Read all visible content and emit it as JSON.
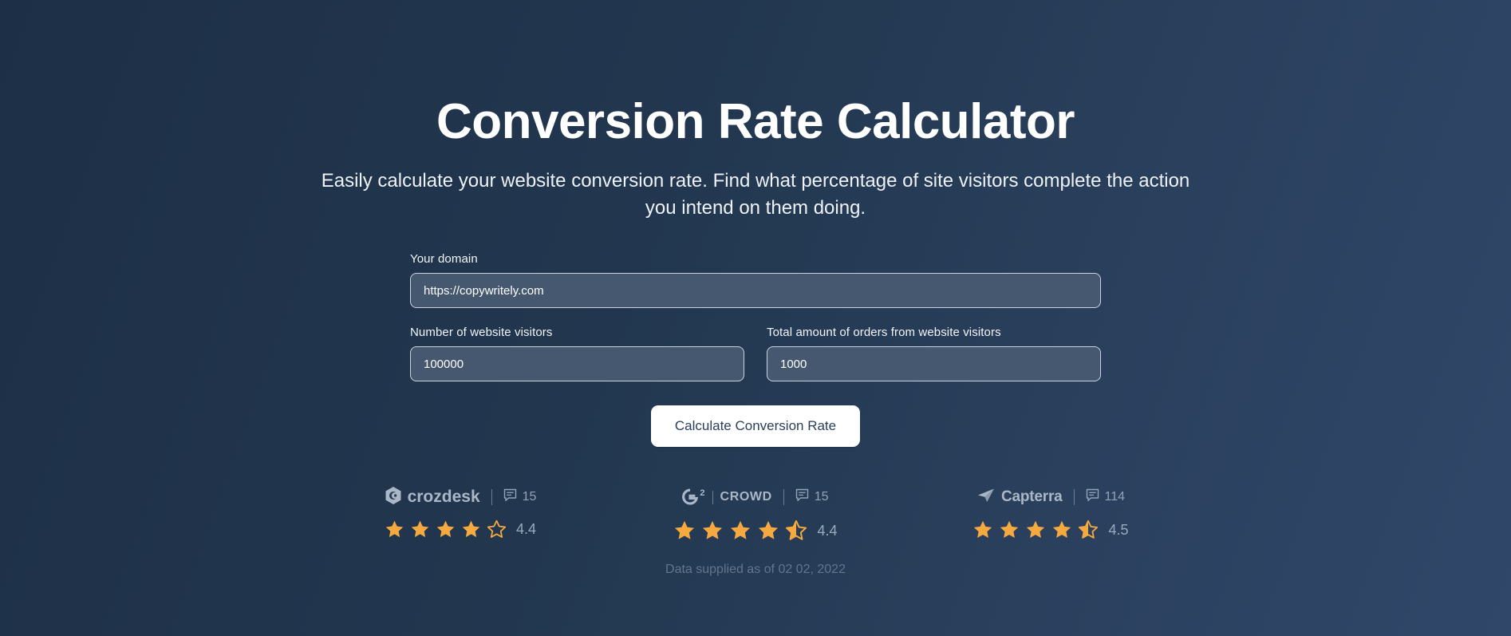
{
  "page": {
    "title": "Conversion Rate Calculator",
    "subtitle": "Easily calculate your website conversion rate. Find what percentage of site visitors complete the action you intend on them doing.",
    "footer_note": "Data supplied as of 02 02, 2022",
    "background_from": "#1d2f47",
    "background_to": "#30476a"
  },
  "form": {
    "domain": {
      "label": "Your domain",
      "value": "https://copywritely.com",
      "placeholder": "https://copywritely.com"
    },
    "visitors": {
      "label": "Number of website visitors",
      "value": "100000",
      "placeholder": "100000"
    },
    "orders": {
      "label": "Total amount of orders from website visitors",
      "value": "1000",
      "placeholder": "1000"
    },
    "submit_label": "Calculate Conversion Rate",
    "input_background": "#46586f",
    "input_border": "#c9d2dd",
    "button_background": "#ffffff",
    "button_text_color": "#2b3e5c"
  },
  "badges": {
    "star_color": "#f5a93f",
    "items": [
      {
        "brand": "crozdesk",
        "logo_icon": "crozdesk-hexagon-logo",
        "review_icon": "speech-bubble-icon",
        "review_count": "15",
        "rating": "4.4",
        "full_stars": 4,
        "half_star": false,
        "empty_stars": 1
      },
      {
        "brand": "CROWD",
        "brand_prefix": "G",
        "brand_superscript": "2",
        "logo_icon": "g2-crowd-logo",
        "review_icon": "speech-bubble-icon",
        "review_count": "15",
        "rating": "4.4",
        "full_stars": 4,
        "half_star": true,
        "empty_stars": 0
      },
      {
        "brand": "Capterra",
        "logo_icon": "capterra-arrow-logo",
        "review_icon": "speech-bubble-icon",
        "review_count": "114",
        "rating": "4.5",
        "full_stars": 4,
        "half_star": true,
        "empty_stars": 0
      }
    ]
  }
}
